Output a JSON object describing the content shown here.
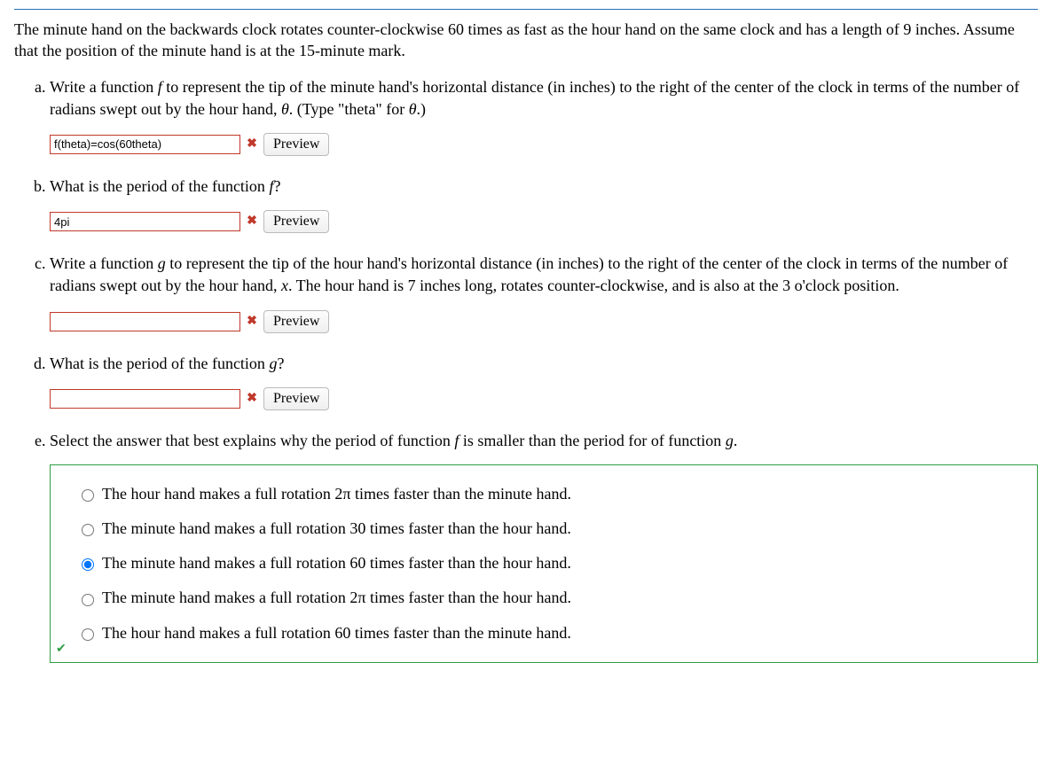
{
  "intro": "The minute hand on the backwards clock rotates counter-clockwise 60 times as fast as the hour hand on the same clock and has a length of 9 inches. Assume that the position of the minute hand is at the 15-minute mark.",
  "parts": {
    "a": {
      "text_before": "Write a function ",
      "f": "f",
      "text_mid": " to represent the tip of the minute hand's horizontal distance (in inches) to the right of the center of the clock in terms of the number of radians swept out by the hour hand, ",
      "theta": "θ",
      "text_after": ". (Type \"theta\" for ",
      "theta2": "θ",
      "text_end": ".)",
      "input_value": "f(theta)=cos(60theta)",
      "preview": "Preview"
    },
    "b": {
      "text_before": "What is the period of the function ",
      "f": "f",
      "text_after": "?",
      "input_value": "4pi",
      "preview": "Preview"
    },
    "c": {
      "text_before": "Write a function ",
      "g": "g",
      "text_mid": " to represent the tip of the hour hand's horizontal distance (in inches) to the right of the center of the clock in terms of the number of radians swept out by the hour hand, ",
      "x": "x",
      "text_after": ". The hour hand is 7 inches long, rotates counter-clockwise, and is also at the 3 o'clock position.",
      "input_value": "",
      "preview": "Preview"
    },
    "d": {
      "text_before": "What is the period of the function ",
      "g": "g",
      "text_after": "?",
      "input_value": "",
      "preview": "Preview"
    },
    "e": {
      "text_before": "Select the answer that best explains why the period of function ",
      "f": "f",
      "text_mid": " is smaller than the period for of function ",
      "g": "g",
      "text_after": ".",
      "choices": [
        "The hour hand makes a full rotation 2π times faster than the minute hand.",
        "The minute hand makes a full rotation 30 times faster than the hour hand.",
        "The minute hand makes a full rotation 60 times faster than the hour hand.",
        "The minute hand makes a full rotation 2π times faster than the hour hand.",
        "The hour hand makes a full rotation 60 times faster than the minute hand."
      ],
      "selected_index": 2
    }
  },
  "icons": {
    "wrong": "✖",
    "correct": "✔"
  }
}
